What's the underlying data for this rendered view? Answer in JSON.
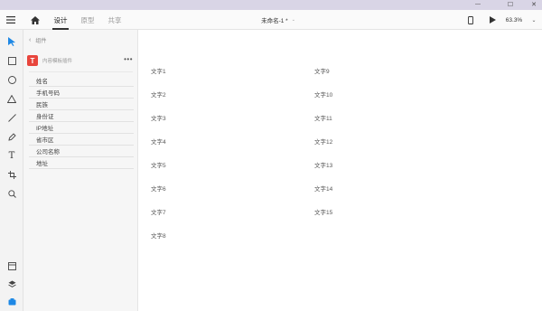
{
  "window": {
    "minimize": "—",
    "maximize": "☐",
    "close": "✕"
  },
  "topbar": {
    "tabs": [
      "设计",
      "原型",
      "共享"
    ],
    "doc_title": "未命名-1 *",
    "zoom": "63.3%"
  },
  "panel": {
    "back_label": "组件",
    "component_name": "内容模板插件",
    "logo_letter": "T",
    "more": "•••",
    "fields": [
      "姓名",
      "手机号码",
      "民族",
      "身份证",
      "IP地址",
      "省市区",
      "公司名称",
      "地址"
    ]
  },
  "canvas": {
    "labels_left": [
      "文字1",
      "文字2",
      "文字3",
      "文字4",
      "文字5",
      "文字6",
      "文字7",
      "文字8"
    ],
    "labels_right": [
      "文字9",
      "文字10",
      "文字11",
      "文字12",
      "文字13",
      "文字14",
      "文字15"
    ]
  },
  "colors": {
    "titlebar": "#d9d5e6",
    "accent": "#1e88e5",
    "logo": "#e8453c"
  },
  "icons": {
    "menu": "menu-icon",
    "home": "home-icon",
    "device": "phone-icon",
    "play": "play-icon",
    "chevron": "chevron-down-icon"
  }
}
